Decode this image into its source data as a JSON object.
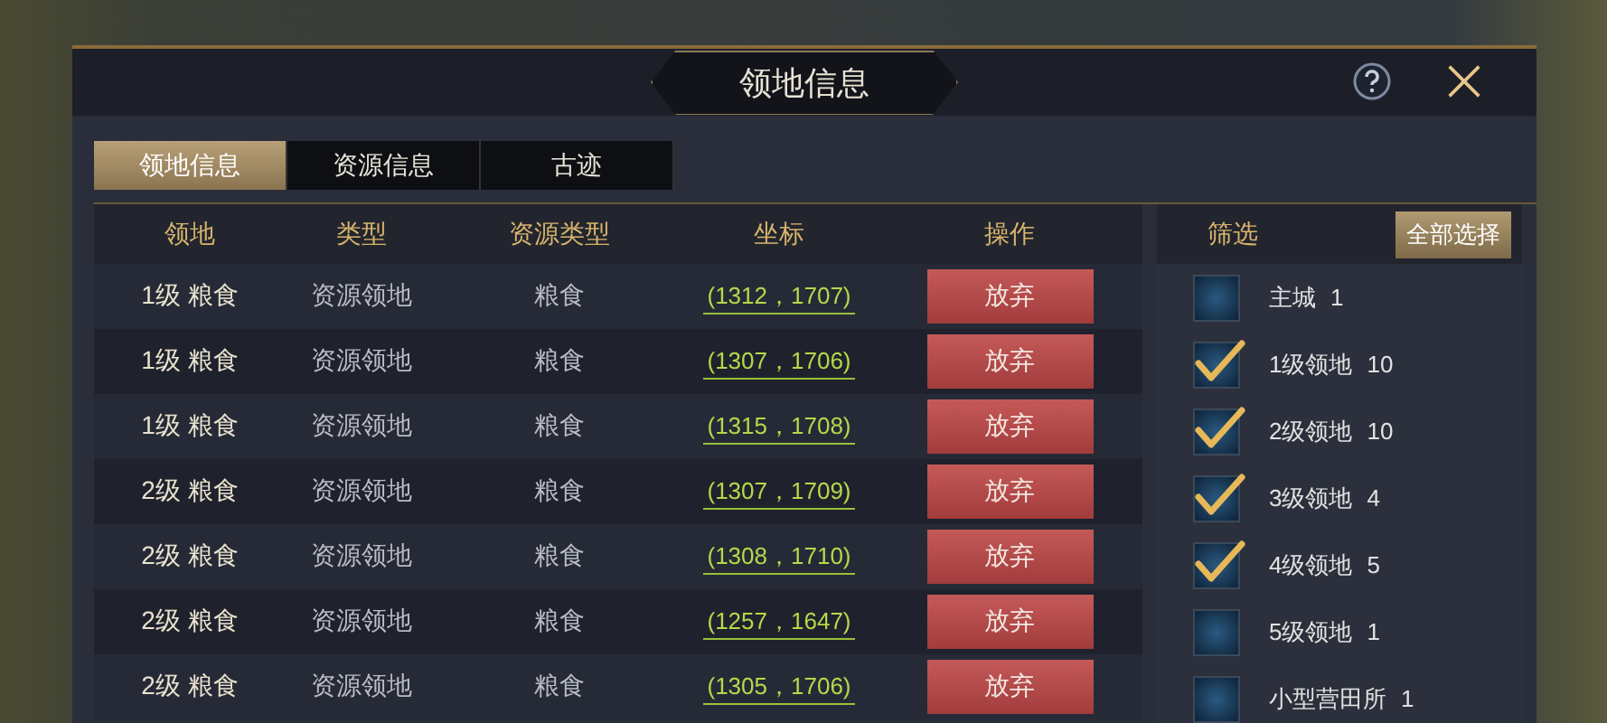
{
  "window": {
    "title": "领地信息"
  },
  "tabs": [
    {
      "label": "领地信息",
      "selected": true
    },
    {
      "label": "资源信息",
      "selected": false
    },
    {
      "label": "古迹",
      "selected": false
    }
  ],
  "table": {
    "columns": [
      "领地",
      "类型",
      "资源类型",
      "坐标",
      "操作"
    ],
    "rows": [
      {
        "territory": "1级 粮食",
        "type": "资源领地",
        "resource": "粮食",
        "coords": "(1312，1707)",
        "action": "放弃"
      },
      {
        "territory": "1级 粮食",
        "type": "资源领地",
        "resource": "粮食",
        "coords": "(1307，1706)",
        "action": "放弃"
      },
      {
        "territory": "1级 粮食",
        "type": "资源领地",
        "resource": "粮食",
        "coords": "(1315，1708)",
        "action": "放弃"
      },
      {
        "territory": "2级 粮食",
        "type": "资源领地",
        "resource": "粮食",
        "coords": "(1307，1709)",
        "action": "放弃"
      },
      {
        "territory": "2级 粮食",
        "type": "资源领地",
        "resource": "粮食",
        "coords": "(1308，1710)",
        "action": "放弃"
      },
      {
        "territory": "2级 粮食",
        "type": "资源领地",
        "resource": "粮食",
        "coords": "(1257，1647)",
        "action": "放弃"
      },
      {
        "territory": "2级 粮食",
        "type": "资源领地",
        "resource": "粮食",
        "coords": "(1305，1706)",
        "action": "放弃"
      }
    ]
  },
  "filter": {
    "title": "筛选",
    "select_all": "全部选择",
    "items": [
      {
        "label": "主城",
        "count": "1",
        "checked": false
      },
      {
        "label": "1级领地",
        "count": "10",
        "checked": true
      },
      {
        "label": "2级领地",
        "count": "10",
        "checked": true
      },
      {
        "label": "3级领地",
        "count": "4",
        "checked": true
      },
      {
        "label": "4级领地",
        "count": "5",
        "checked": true
      },
      {
        "label": "5级领地",
        "count": "1",
        "checked": false
      },
      {
        "label": "小型营田所",
        "count": "1",
        "checked": false
      }
    ]
  }
}
